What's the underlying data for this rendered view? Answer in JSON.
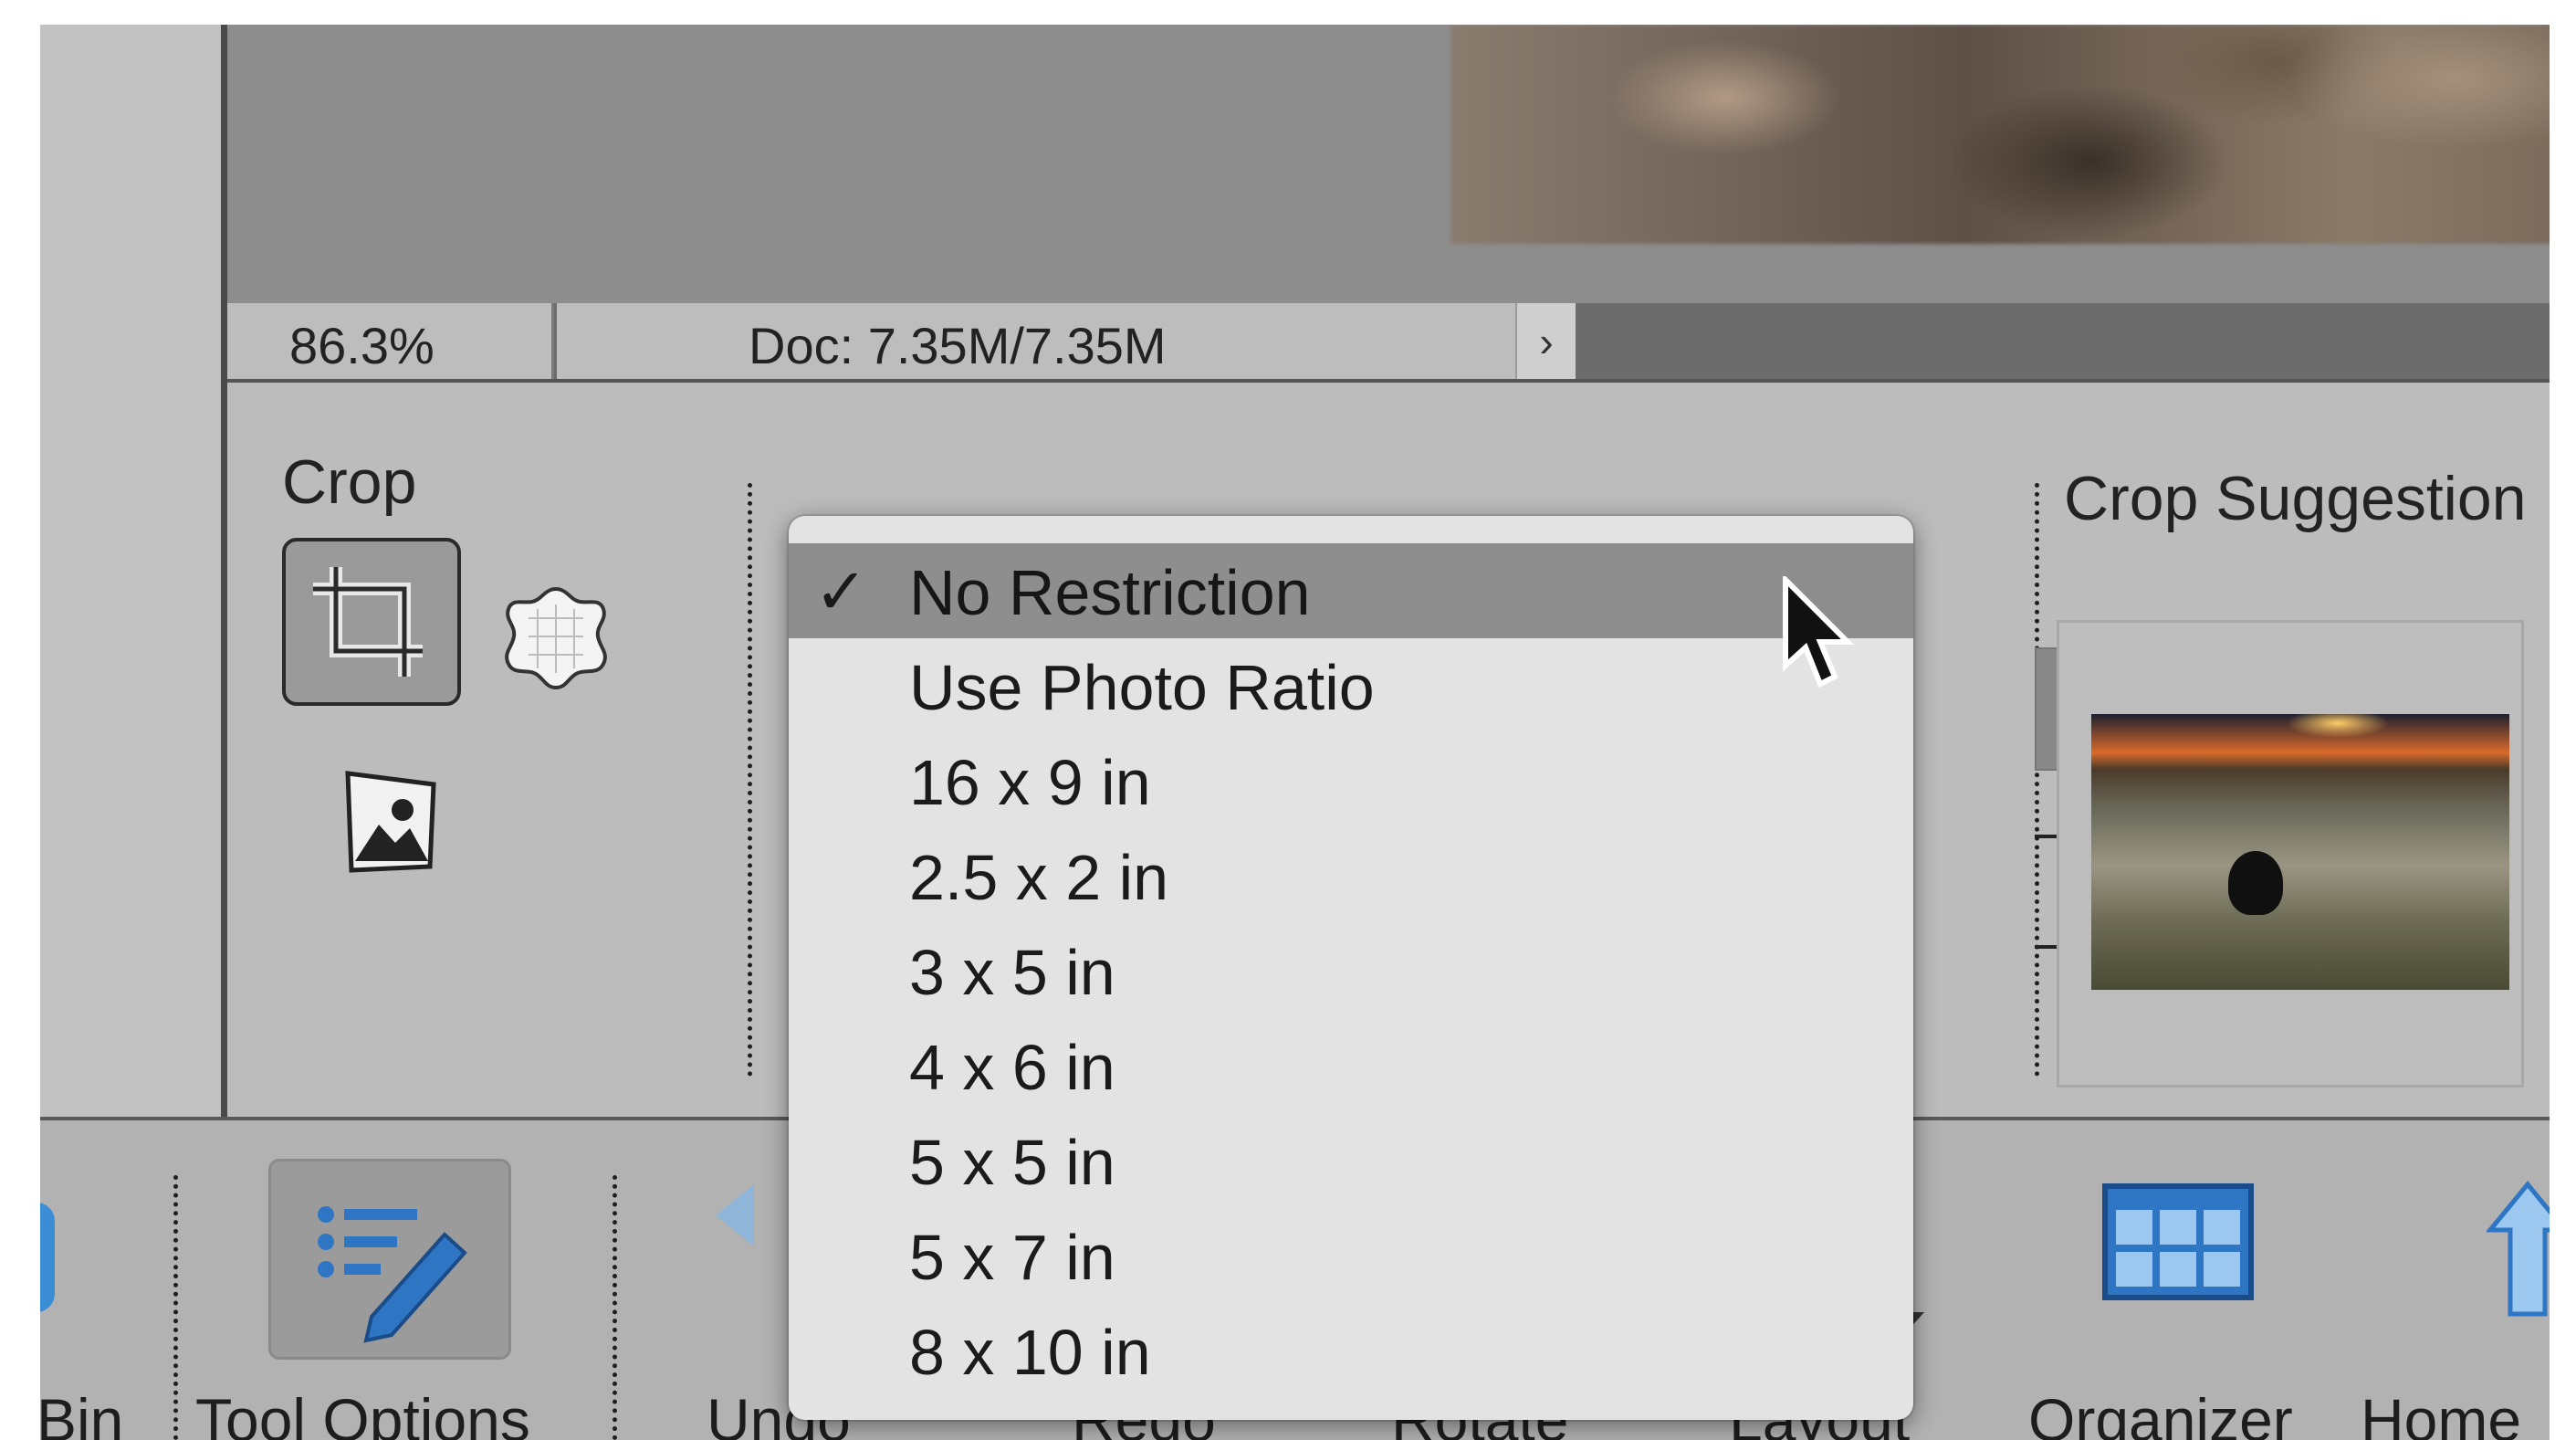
{
  "status_bar": {
    "zoom": "86.3%",
    "doc_size": "Doc: 7.35M/7.35M",
    "expand_arrow": "›"
  },
  "tool_options": {
    "section_title": "Crop",
    "crop_suggestions_title": "Crop Suggestion"
  },
  "aspect_ratio_menu": {
    "selected_index": 0,
    "check_mark": "✓",
    "items": [
      "No Restriction",
      "Use Photo Ratio",
      "16 x 9 in",
      "2.5 x 2 in",
      "3 x 5 in",
      "4 x 6 in",
      "5 x 5 in",
      "5 x 7 in",
      "8 x 10 in"
    ]
  },
  "bottom_panel": {
    "bin_label": "Bin",
    "tool_options_label": "Tool Options",
    "undo_label": "Undo",
    "redo_label": "Redo",
    "rotate_label": "Rotate",
    "layout_label": "Layout",
    "organizer_label": "Organizer",
    "home_label": "Home"
  },
  "colors": {
    "menu_background": "#e3e3e3",
    "menu_selected": "#8e8e8e",
    "panel_gray": "#bcbcbc",
    "icon_blue": "#2e75c4"
  }
}
